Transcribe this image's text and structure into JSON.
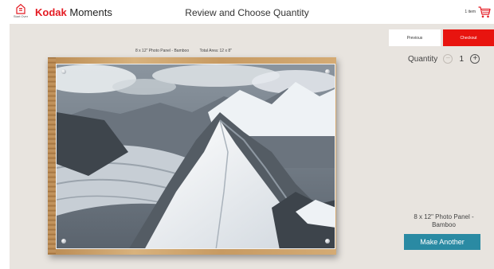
{
  "header": {
    "start_over_label": "Start Over",
    "brand_name": "Kodak",
    "brand_product": "Moments",
    "title": "Review and Choose Quantity",
    "cart_count_label": "1 item",
    "cart_icon": "shopping-cart-icon",
    "brand_color": "#e41b23"
  },
  "toolbar": {
    "previous_label": "Previous",
    "checkout_label": "Checkout",
    "checkout_color": "#e8140f"
  },
  "product": {
    "name_size": "8 x 12\" Photo Panel - Bamboo",
    "total_area": "Total Area: 12 x 8\"",
    "right_name": "8 x 12\" Photo Panel - Bamboo"
  },
  "quantity": {
    "label": "Quantity",
    "value": "1",
    "minus_symbol": "−",
    "plus_symbol": "+"
  },
  "actions": {
    "make_another_label": "Make Another",
    "make_another_color": "#2a8aa3"
  }
}
